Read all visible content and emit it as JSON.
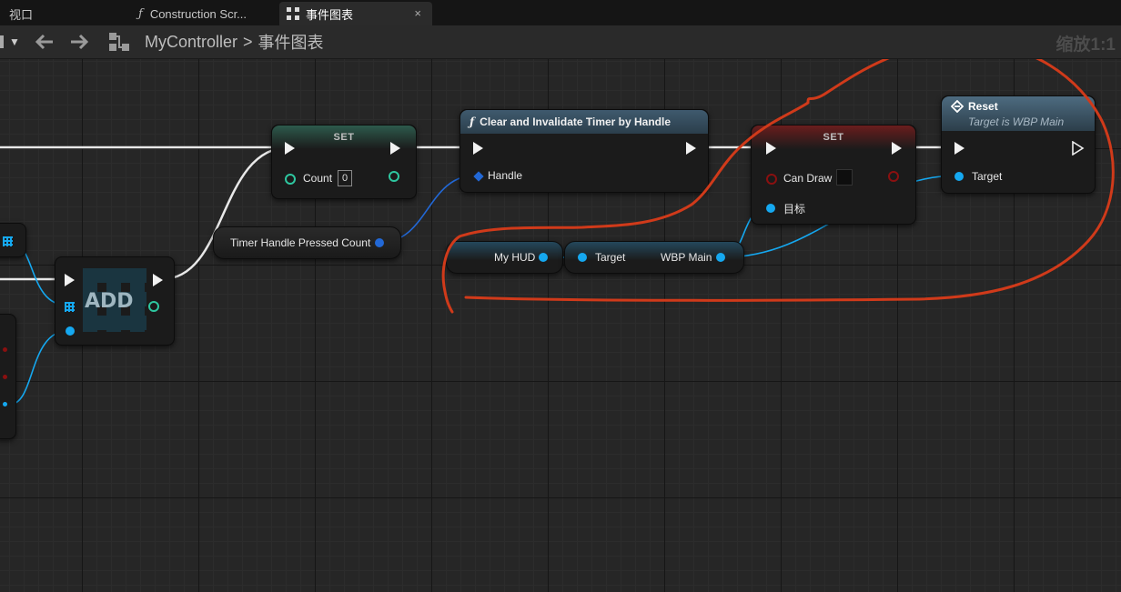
{
  "tabs": [
    {
      "label": "视口"
    },
    {
      "label": "Construction Scr..."
    },
    {
      "label": "事件图表",
      "close": "×"
    }
  ],
  "breadcrumb": {
    "root": "MyController",
    "separator": ">",
    "current": "事件图表"
  },
  "zoom": "缩放1:1",
  "nodes": {
    "set_count": {
      "title": "SET",
      "label": "Count",
      "value": "0"
    },
    "add": {
      "title": "ADD"
    },
    "timer_var": {
      "label": "Timer Handle Pressed Count"
    },
    "clear_timer": {
      "title": "Clear and Invalidate Timer by Handle",
      "pin": "Handle"
    },
    "set_candraw": {
      "title": "SET",
      "label": "Can Draw",
      "target": "目标"
    },
    "myhud": {
      "label": "My HUD"
    },
    "wbp_main": {
      "input": "Target",
      "output": "WBP Main"
    },
    "reset": {
      "title": "Reset",
      "subtitle": "Target is WBP Main",
      "pin": "Target"
    }
  },
  "colors": {
    "exec": "#f2f2f2",
    "object_pin": "#15a8f0",
    "int_pin": "#2ec7a0",
    "bool_pin": "#8a1010",
    "struct_pin": "#2268d6",
    "annotation": "#d03a1a"
  }
}
